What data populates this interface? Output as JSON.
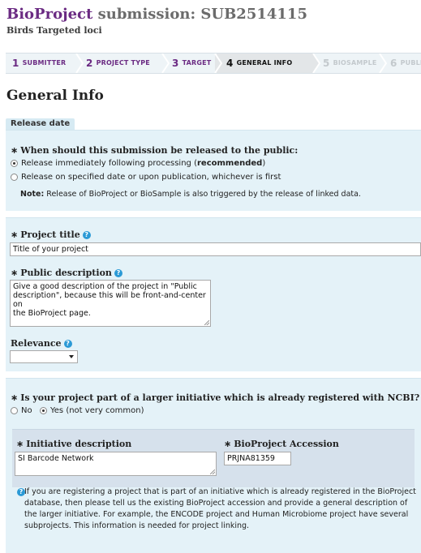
{
  "header": {
    "brand": "BioProject",
    "title_rest": " submission: SUB2514115",
    "subtitle": "Birds Targeted loci"
  },
  "steps": [
    {
      "num": "1",
      "label": "SUBMITTER",
      "state": "done"
    },
    {
      "num": "2",
      "label": "PROJECT TYPE",
      "state": "done"
    },
    {
      "num": "3",
      "label": "TARGET",
      "state": "done"
    },
    {
      "num": "4",
      "label": "GENERAL INFO",
      "state": "active"
    },
    {
      "num": "5",
      "label": "BIOSAMPLE",
      "state": "disabled"
    },
    {
      "num": "6",
      "label": "PUBLI",
      "state": "disabled"
    }
  ],
  "page_heading": "General Info",
  "release": {
    "tab_label": "Release date",
    "question": "When should this submission be released to the public:",
    "option_immediate_prefix": "Release immediately following processing (",
    "option_immediate_bold": "recommended",
    "option_immediate_suffix": ")",
    "option_specified": "Release on specified date or upon publication, whichever is first",
    "note_label": "Note:",
    "note_text": " Release of BioProject or BioSample is also triggered by the release of linked data.",
    "selected": "immediate"
  },
  "project": {
    "title_label": "Project title",
    "title_value": "Title of your project",
    "description_label": "Public description",
    "description_lines": [
      "Give a good description of the project in \"Public",
      "description\", because this will be front-and-center on",
      "the BioProject page."
    ],
    "relevance_label": "Relevance",
    "relevance_value": ""
  },
  "initiative": {
    "question": "Is your project part of a larger initiative which is already registered with NCBI?",
    "option_no": "No",
    "option_yes": "Yes (not very common)",
    "selected": "yes",
    "description_label": "Initiative description",
    "description_value": "SI Barcode Network",
    "accession_label": "BioProject Accession",
    "accession_value": "PRJNA81359",
    "info_lines": [
      "If you are registering a project that is part of an initiative which is already registered in the BioProject",
      "database, then please tell us the existing BioProject accession and provide a general description of",
      "the larger initiative. For example, the ENCODE project and Human Microbiome project have several",
      "subprojects. This information is needed for project linking."
    ]
  },
  "icons": {
    "required": "asterisk-icon",
    "help": "help-icon",
    "info": "info-icon"
  },
  "colors": {
    "brand_purple": "#6b2b83",
    "panel_blue": "#e4f2f8",
    "help_blue": "#2b9ad6"
  }
}
